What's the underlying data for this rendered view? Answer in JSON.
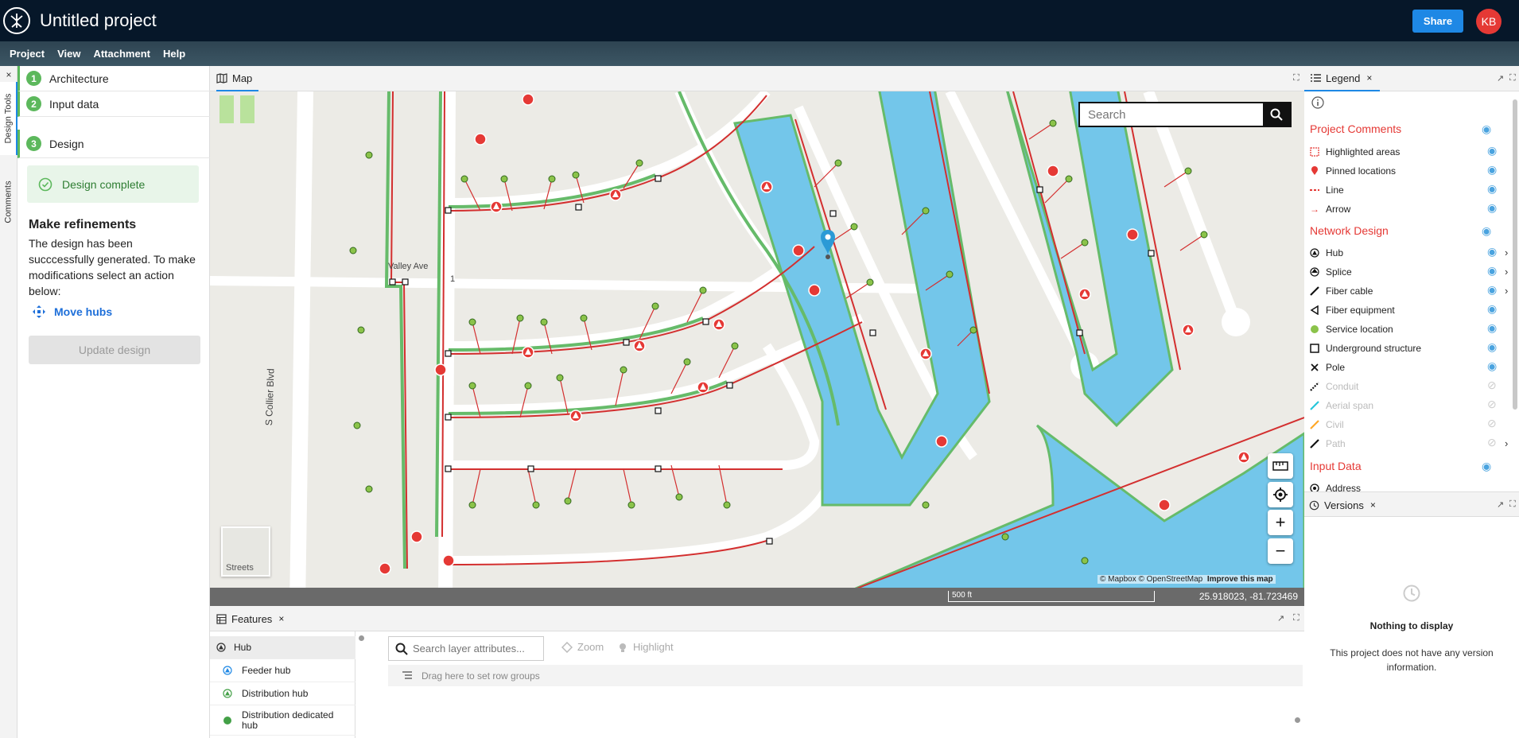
{
  "app": {
    "title": "Untitled project",
    "share_label": "Share",
    "user_initials": "KB"
  },
  "menu": [
    "Project",
    "View",
    "Attachment",
    "Help"
  ],
  "side_tabs": {
    "design_tools": "Design Tools",
    "comments": "Comments"
  },
  "steps": [
    {
      "num": "1",
      "label": "Architecture"
    },
    {
      "num": "2",
      "label": "Input data"
    },
    {
      "num": "3",
      "label": "Design"
    }
  ],
  "design": {
    "status": "Design complete",
    "refine_title": "Make refinements",
    "refine_desc": "The design has been succcessfully generated. To make modifications select an action below:",
    "move_hubs": "Move hubs",
    "update_label": "Update design"
  },
  "map": {
    "tab_label": "Map",
    "search_placeholder": "Search",
    "streets": [
      "Valley Ave",
      "S Collier Blvd"
    ],
    "basemap_label": "Streets",
    "attribution": "© Mapbox © OpenStreetMap",
    "improve_label": "Improve this map",
    "scale_label": "500 ft",
    "coordinates": "25.918023, -81.723469",
    "hub_label": "1"
  },
  "features": {
    "tab_label": "Features",
    "layers": [
      "Hub",
      "Feeder hub",
      "Distribution hub",
      "Distribution dedicated hub"
    ],
    "search_placeholder": "Search layer attributes...",
    "zoom_label": "Zoom",
    "highlight_label": "Highlight",
    "group_hint": "Drag here to set row groups"
  },
  "legend": {
    "tab_label": "Legend",
    "sections": [
      {
        "title": "Project Comments",
        "items": [
          {
            "label": "Highlighted areas",
            "icon": "highlight-area-icon",
            "color": "#e53935"
          },
          {
            "label": "Pinned locations",
            "icon": "pin-icon",
            "color": "#e53935"
          },
          {
            "label": "Line",
            "icon": "dashed-line-icon",
            "color": "#e53935"
          },
          {
            "label": "Arrow",
            "icon": "arrow-icon",
            "color": "#e53935"
          }
        ]
      },
      {
        "title": "Network Design",
        "items": [
          {
            "label": "Hub",
            "icon": "hub-icon"
          },
          {
            "label": "Splice",
            "icon": "splice-icon"
          },
          {
            "label": "Fiber cable",
            "icon": "fiber-cable-icon"
          },
          {
            "label": "Fiber equipment",
            "icon": "fiber-equipment-icon"
          },
          {
            "label": "Service location",
            "icon": "service-location-icon",
            "color": "#8bc34a"
          },
          {
            "label": "Underground structure",
            "icon": "underground-structure-icon"
          },
          {
            "label": "Pole",
            "icon": "pole-icon"
          },
          {
            "label": "Conduit",
            "icon": "conduit-icon"
          },
          {
            "label": "Aerial span",
            "icon": "aerial-span-icon",
            "color": "#26c6da"
          },
          {
            "label": "Civil",
            "icon": "civil-icon",
            "color": "#ffa726"
          },
          {
            "label": "Path",
            "icon": "path-icon"
          }
        ]
      },
      {
        "title": "Input Data",
        "items": [
          {
            "label": "Address",
            "icon": "address-icon"
          }
        ]
      }
    ]
  },
  "versions": {
    "tab_label": "Versions",
    "empty_title": "Nothing to display",
    "empty_desc": "This project does not have any version information."
  },
  "colors": {
    "accent": "#1e88e5",
    "header_bg": "#061729",
    "section_red": "#e53935",
    "step_green": "#5cb85c",
    "water": "#73c6ea",
    "fiber_red": "#d32f2f",
    "conduit_green": "#66bb6a"
  }
}
